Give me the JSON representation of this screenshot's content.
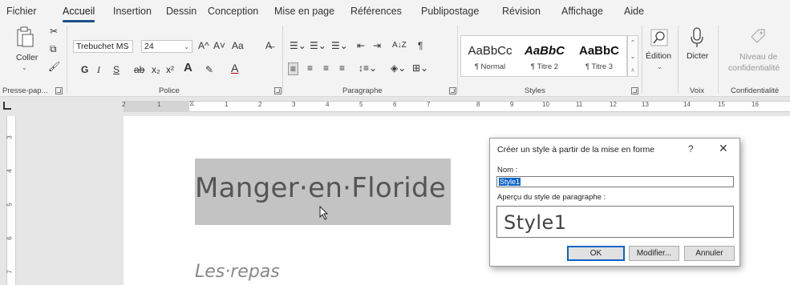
{
  "tabs": [
    "Fichier",
    "Accueil",
    "Insertion",
    "Dessin",
    "Conception",
    "Mise en page",
    "Références",
    "Publipostage",
    "Révision",
    "Affichage",
    "Aide"
  ],
  "active_tab": "Accueil",
  "clipboard": {
    "paste_label": "Coller",
    "group_label": "Presse-pap..."
  },
  "font": {
    "font_name": "Trebuchet MS",
    "font_size": "24",
    "grow_icon": "A^",
    "shrink_icon": "A˅",
    "case_icon": "Aa",
    "clear_icon": "A̶",
    "bold": "G",
    "italic": "I",
    "underline": "S",
    "strike": "ab",
    "subscript": "x₂",
    "superscript": "x²",
    "text_effects": "A",
    "highlight": "✎",
    "font_color": "A",
    "group_label": "Police"
  },
  "paragraph": {
    "group_label": "Paragraphe",
    "sort_icon": "A↓Z",
    "pilcrow": "¶"
  },
  "styles": {
    "items": [
      {
        "sample": "AaBbCc",
        "name": "¶ Normal"
      },
      {
        "sample": "AaBbC",
        "name": "¶ Titre 2"
      },
      {
        "sample": "AaBbC",
        "name": "¶ Titre 3"
      }
    ],
    "group_label": "Styles"
  },
  "editing": {
    "label": "Édition"
  },
  "voice": {
    "dictate_label": "Dicter",
    "group_label": "Voix"
  },
  "sensitivity": {
    "label_line1": "Niveau de",
    "label_line2": "confidentialité",
    "group_label": "Confidentialité"
  },
  "ruler": {
    "horizontal": [
      "2",
      "1",
      "1",
      "2",
      "3",
      "4",
      "5",
      "6",
      "7",
      "8",
      "9",
      "10",
      "11",
      "12",
      "13",
      "14",
      "15",
      "16"
    ],
    "vertical": [
      "3",
      "4",
      "5",
      "6",
      "7"
    ]
  },
  "document": {
    "heading": "Manger·en·Floride",
    "subheading": "Les·repas"
  },
  "dialog": {
    "title": "Créer un style à partir de la mise en forme",
    "help": "?",
    "close": "✕",
    "name_label": "Nom :",
    "name_value": "Style1",
    "preview_label": "Aperçu du style de paragraphe :",
    "preview_text": "Style1",
    "ok_label": "OK",
    "modify_label": "Modifier...",
    "cancel_label": "Annuler"
  },
  "colors": {
    "accent": "#1e4e8c",
    "selection": "#c3c3c3",
    "text_selection": "#0a64c8"
  }
}
